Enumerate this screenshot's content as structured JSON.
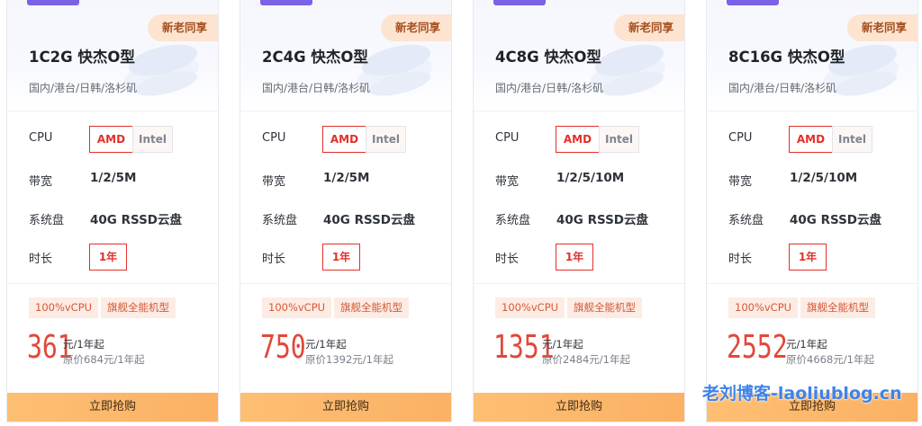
{
  "labels": {
    "cpu": "CPU",
    "bandwidth": "带宽",
    "disk": "系统盘",
    "duration": "时长"
  },
  "cards": [
    {
      "badge": "新老同享",
      "title": "1C2G 快杰O型",
      "regions": "国内/港台/日韩/洛杉矶",
      "cpu_options": [
        "AMD",
        "Intel"
      ],
      "cpu_selected": "AMD",
      "bandwidth": "1/2/5M",
      "disk": "40G RSSD云盘",
      "duration": "1年",
      "tags": [
        "100%vCPU",
        "旗舰全能机型"
      ],
      "price": "361",
      "unit": "元/1年起",
      "original": "原价684元/1年起",
      "buy_label": "立即抢购"
    },
    {
      "badge": "新老同享",
      "title": "2C4G 快杰O型",
      "regions": "国内/港台/日韩/洛杉矶",
      "cpu_options": [
        "AMD",
        "Intel"
      ],
      "cpu_selected": "AMD",
      "bandwidth": "1/2/5M",
      "disk": "40G RSSD云盘",
      "duration": "1年",
      "tags": [
        "100%vCPU",
        "旗舰全能机型"
      ],
      "price": "750",
      "unit": "元/1年起",
      "original": "原价1392元/1年起",
      "buy_label": "立即抢购"
    },
    {
      "badge": "新老同享",
      "title": "4C8G 快杰O型",
      "regions": "国内/港台/日韩/洛杉矶",
      "cpu_options": [
        "AMD",
        "Intel"
      ],
      "cpu_selected": "AMD",
      "bandwidth": "1/2/5/10M",
      "disk": "40G RSSD云盘",
      "duration": "1年",
      "tags": [
        "100%vCPU",
        "旗舰全能机型"
      ],
      "price": "1351",
      "unit": "元/1年起",
      "original": "原价2484元/1年起",
      "buy_label": "立即抢购"
    },
    {
      "badge": "新老同享",
      "title": "8C16G 快杰O型",
      "regions": "国内/港台/日韩/洛杉矶",
      "cpu_options": [
        "AMD",
        "Intel"
      ],
      "cpu_selected": "AMD",
      "bandwidth": "1/2/5/10M",
      "disk": "40G RSSD云盘",
      "duration": "1年",
      "tags": [
        "100%vCPU",
        "旗舰全能机型"
      ],
      "price": "2552",
      "unit": "元/1年起",
      "original": "原价4668元/1年起",
      "buy_label": "立即抢购"
    }
  ],
  "watermark": "老刘博客-laoliublog.cn",
  "colors": {
    "accent_purple": "#7b61e6",
    "price_red": "#e2473a",
    "active_border": "#e2312a",
    "buy_button": "#fdbf73",
    "badge_bg": "#fde4d0",
    "tag_bg": "#fdece4",
    "watermark_blue": "#3f82e8"
  }
}
